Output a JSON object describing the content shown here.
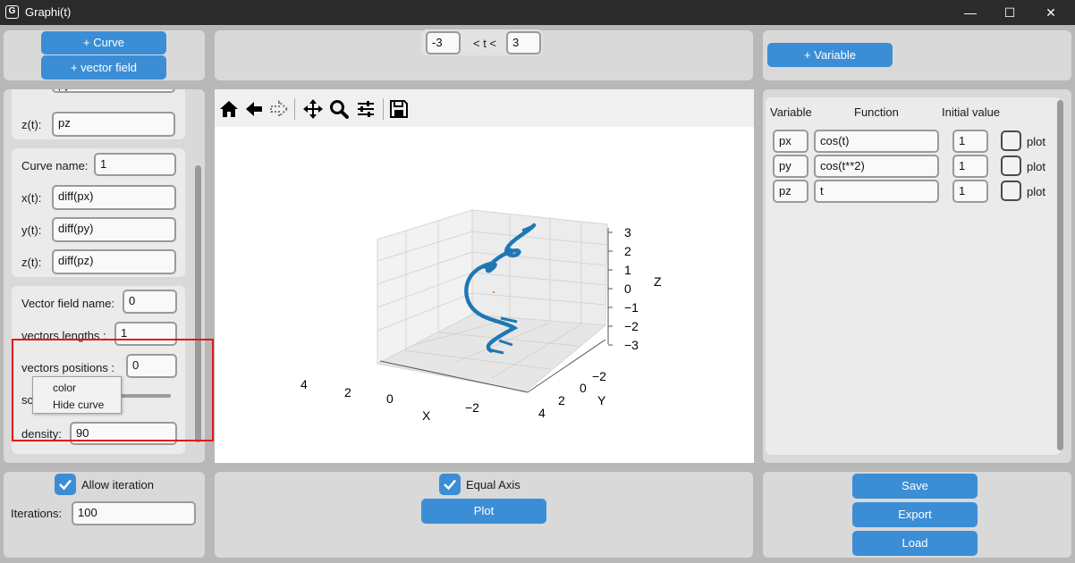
{
  "window": {
    "title": "Graphi(t)",
    "app_icon": "G",
    "minimize": "—",
    "maximize": "☐",
    "close": "✕"
  },
  "left_top": {
    "add_curve": "+ Curve",
    "add_vector_field": "+ vector field"
  },
  "time_range": {
    "t_min": "-3",
    "label": "< t <",
    "t_max": "3"
  },
  "right_top": {
    "add_variable": "+ Variable"
  },
  "curve_prev": {
    "z_label": "z(t):",
    "z_value": "pz"
  },
  "curve": {
    "name_label": "Curve name:",
    "name_value": "1",
    "x_label": "x(t):",
    "x_value": "diff(px)",
    "y_label": "y(t):",
    "y_value": "diff(py)",
    "z_label": "z(t):",
    "z_value": "diff(pz)"
  },
  "vector_field": {
    "name_label": "Vector field name:",
    "name_value": "0",
    "lengths_label": "vectors lengths :",
    "lengths_value": "1",
    "positions_label": "vectors positions :",
    "positions_value": "0",
    "scale_label_visible": "sc",
    "density_label": "density:",
    "density_value": "90"
  },
  "context_menu": {
    "items": [
      "color",
      "Hide curve"
    ]
  },
  "plot": {
    "toolbar_icons": [
      "home-icon",
      "back-icon",
      "forward-icon",
      "pan-icon",
      "zoom-icon",
      "configure-icon",
      "save-icon"
    ],
    "axis_labels": {
      "x": "X",
      "y": "Y",
      "z": "Z"
    },
    "x_ticks": [
      "4",
      "2",
      "0",
      "−2"
    ],
    "y_ticks": [
      "−2",
      "0",
      "2",
      "4"
    ],
    "z_ticks": [
      "3",
      "2",
      "1",
      "0",
      "−1",
      "−2",
      "−3"
    ],
    "curve_color": "#1f77b4",
    "marker_color": "#ff7f0e"
  },
  "variables": {
    "headers": {
      "variable": "Variable",
      "function": "Function",
      "initial": "Initial value"
    },
    "plot_label": "plot",
    "rows": [
      {
        "name": "px",
        "function": "cos(t)",
        "initial": "1"
      },
      {
        "name": "py",
        "function": "cos(t**2)",
        "initial": "1"
      },
      {
        "name": "pz",
        "function": "t",
        "initial": "1"
      }
    ]
  },
  "bottom_left": {
    "allow_iteration": "Allow iteration",
    "iterations_label": "Iterations:",
    "iterations_value": "100"
  },
  "bottom_center": {
    "equal_axis": "Equal Axis",
    "plot_button": "Plot"
  },
  "bottom_right": {
    "save": "Save",
    "export": "Export",
    "load": "Load"
  },
  "colors": {
    "accent": "#3b8ed6",
    "highlight": "#e4161d"
  }
}
